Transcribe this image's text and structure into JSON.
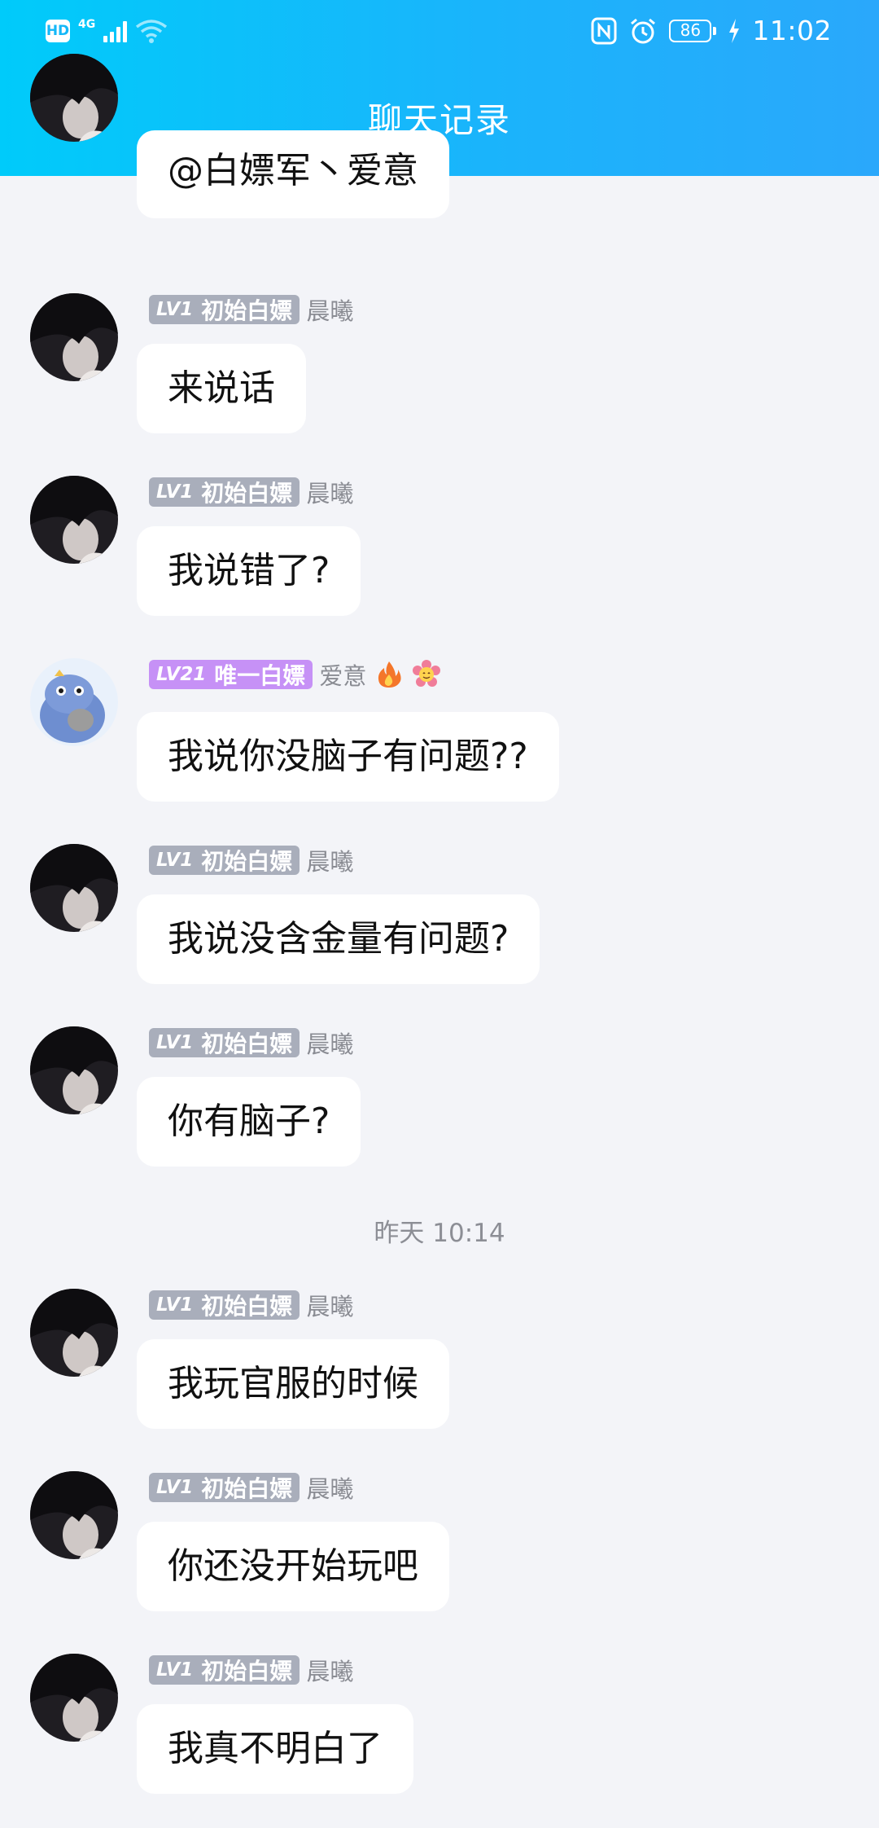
{
  "status_bar": {
    "hd": "HD",
    "network": "4G",
    "battery": "86",
    "time": "11:02"
  },
  "header": {
    "title": "聊天记录"
  },
  "partial_message": {
    "text": "@白嫖军丶爱意"
  },
  "messages": [
    {
      "level": "LV1",
      "role": "初始白嫖",
      "name": "晨曦",
      "text": "来说话",
      "avatar": "avatar-dark-hair",
      "badge_color": "#a9aebb"
    },
    {
      "level": "LV1",
      "role": "初始白嫖",
      "name": "晨曦",
      "text": "我说错了?",
      "avatar": "avatar-dark-hair",
      "badge_color": "#a9aebb"
    },
    {
      "level": "LV21",
      "role": "唯一白嫖",
      "name": "爱意",
      "text": "我说你没脑子有问题??",
      "avatar": "avatar-blue-dino",
      "badge_color": "#c691f6"
    },
    {
      "level": "LV1",
      "role": "初始白嫖",
      "name": "晨曦",
      "text": "我说没含金量有问题?",
      "avatar": "avatar-dark-hair",
      "badge_color": "#a9aebb"
    },
    {
      "level": "LV1",
      "role": "初始白嫖",
      "name": "晨曦",
      "text": "你有脑子?",
      "avatar": "avatar-dark-hair",
      "badge_color": "#a9aebb"
    },
    {
      "level": "LV1",
      "role": "初始白嫖",
      "name": "晨曦",
      "text": "我玩官服的时候",
      "avatar": "avatar-dark-hair",
      "badge_color": "#a9aebb"
    },
    {
      "level": "LV1",
      "role": "初始白嫖",
      "name": "晨曦",
      "text": "你还没开始玩吧",
      "avatar": "avatar-dark-hair",
      "badge_color": "#a9aebb"
    },
    {
      "level": "LV1",
      "role": "初始白嫖",
      "name": "晨曦",
      "text": "我真不明白了",
      "avatar": "avatar-dark-hair",
      "badge_color": "#a9aebb"
    }
  ],
  "divider": {
    "timestamp": "昨天 10:14"
  },
  "icons": {
    "back": "chevron-left-icon",
    "fire": "fire-emoji",
    "flower": "flower-emoji"
  },
  "colors": {
    "header_start": "#00cbfa",
    "header_end": "#2aa8fb",
    "background": "#f3f4f8"
  }
}
